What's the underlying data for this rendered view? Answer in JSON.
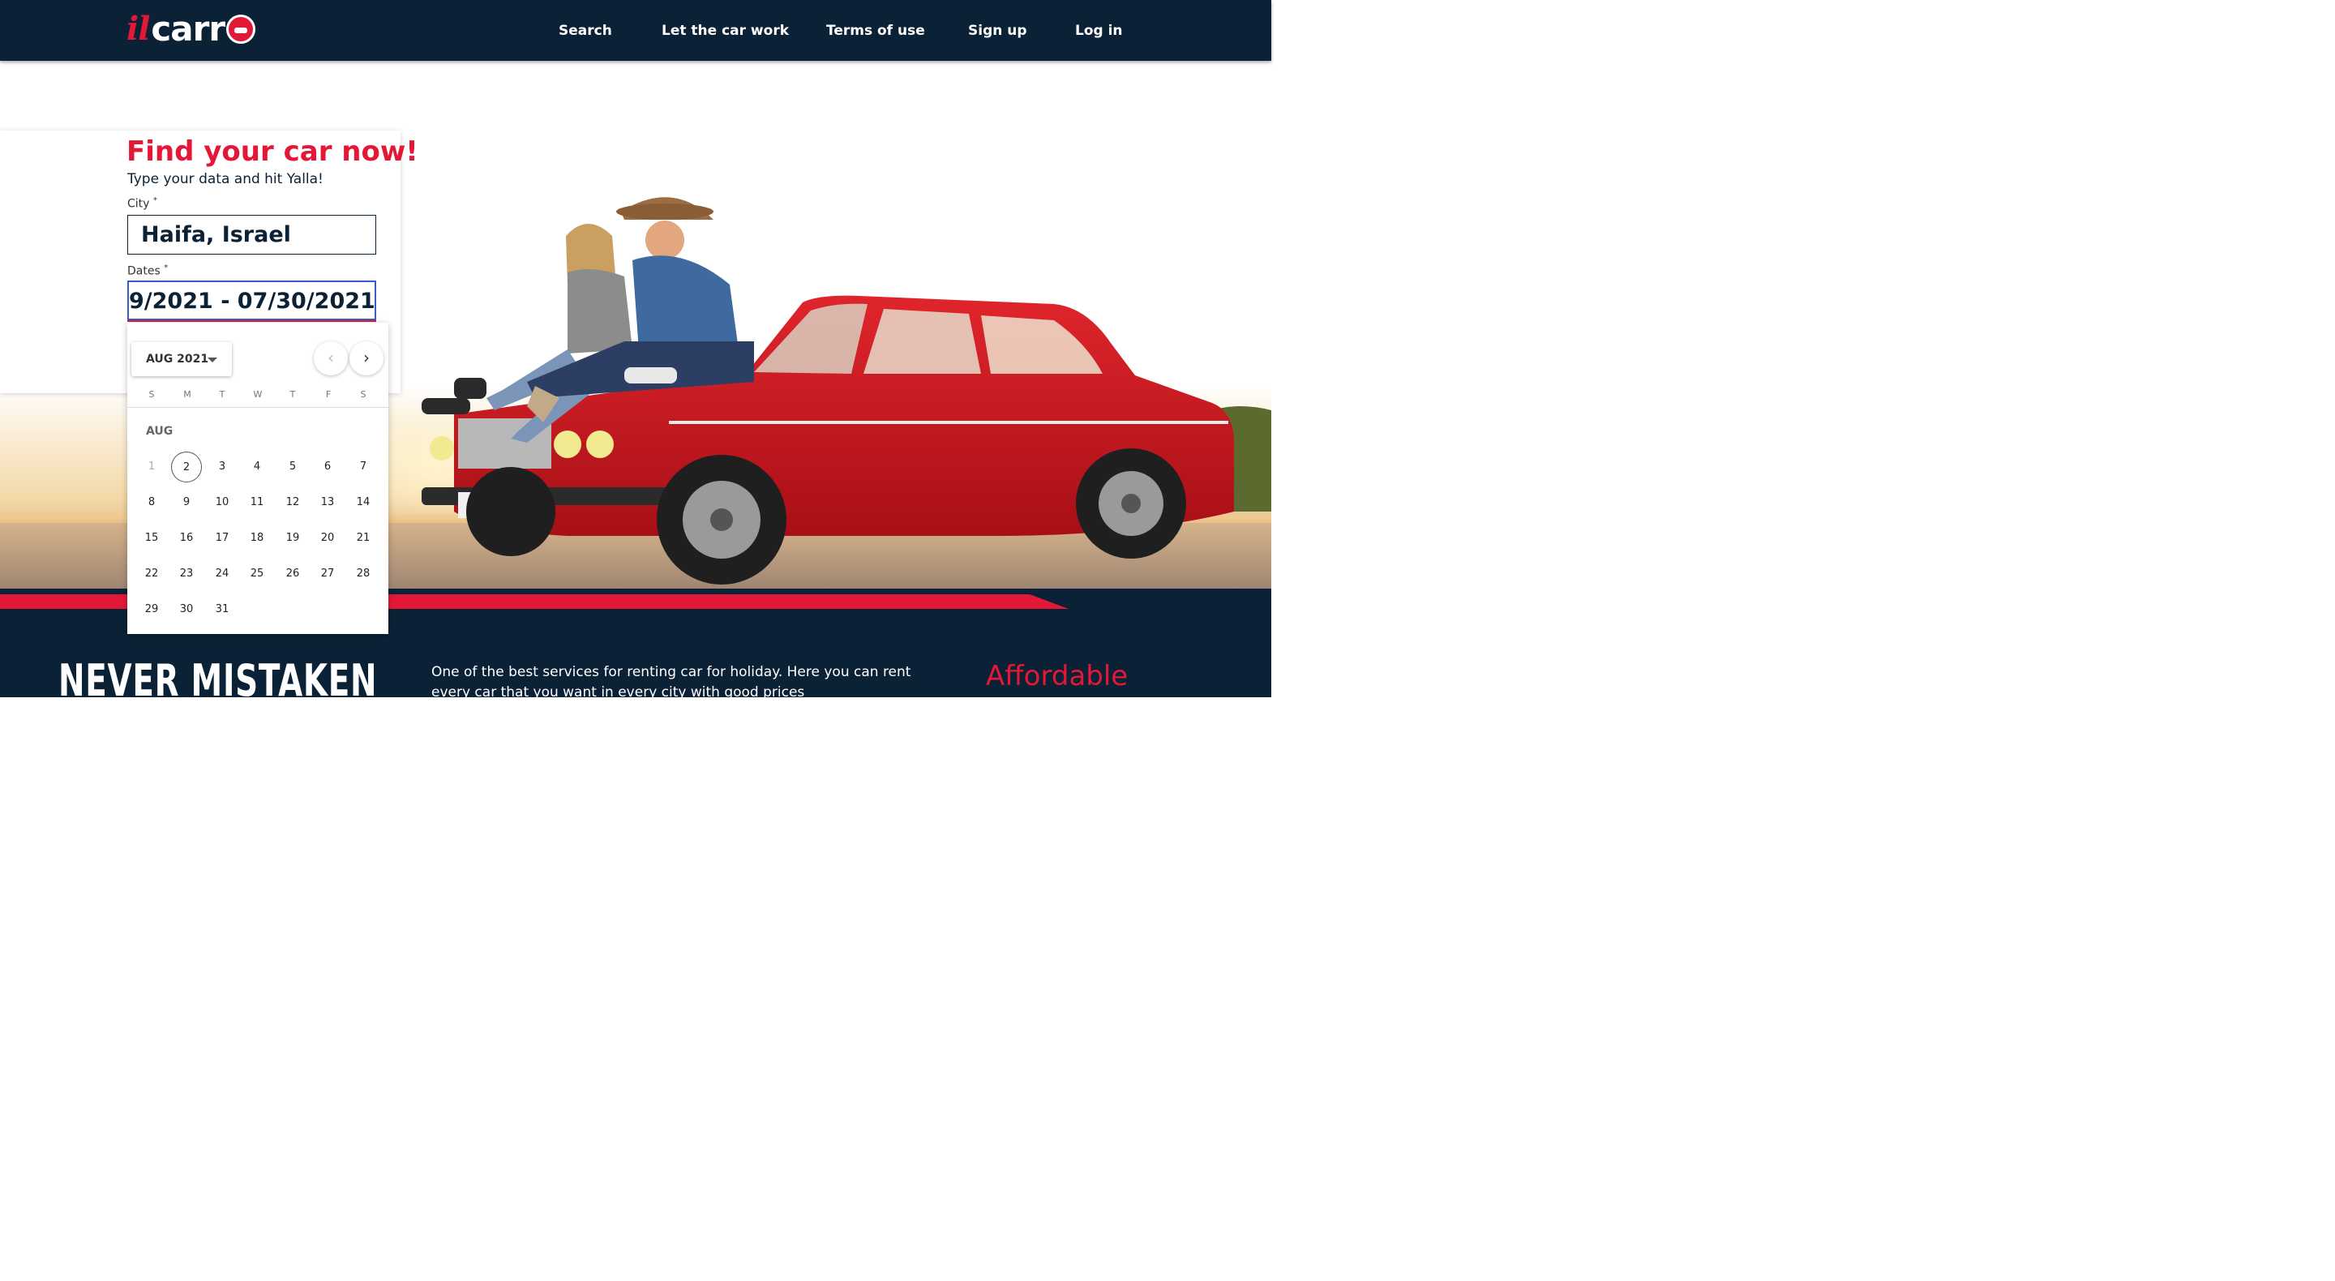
{
  "header": {
    "logo_il": "il",
    "logo_text": "carr",
    "nav": [
      "Search",
      "Let the car work",
      "Terms of use",
      "Sign up",
      "Log in"
    ]
  },
  "form": {
    "title": "Find your car now!",
    "subtitle": "Type your data and hit Yalla!",
    "city_label": "City",
    "city_value": "Haifa, Israel",
    "dates_label": "Dates",
    "dates_value": "9/2021 - 07/30/2021",
    "required_mark": "*"
  },
  "datepicker": {
    "month_year": "AUG 2021",
    "weekdays": [
      "S",
      "M",
      "T",
      "W",
      "T",
      "F",
      "S"
    ],
    "month_label": "AUG",
    "prev_icon": "‹",
    "next_icon": "›",
    "days": [
      "1",
      "2",
      "3",
      "4",
      "5",
      "6",
      "7",
      "8",
      "9",
      "10",
      "11",
      "12",
      "13",
      "14",
      "15",
      "16",
      "17",
      "18",
      "19",
      "20",
      "21",
      "22",
      "23",
      "24",
      "25",
      "26",
      "27",
      "28",
      "29",
      "30",
      "31"
    ],
    "disabled_days": [
      "1"
    ],
    "today": "2"
  },
  "footer": {
    "slogan": "NEVER MISTAKEN",
    "about": "One of the best services for renting car for holiday. Here you can rent every car that you want in every city with good prices",
    "affordable": "Affordable"
  },
  "colors": {
    "navy": "#0b2136",
    "accent_red": "#e31837",
    "focus_blue": "#3b5cc4"
  }
}
